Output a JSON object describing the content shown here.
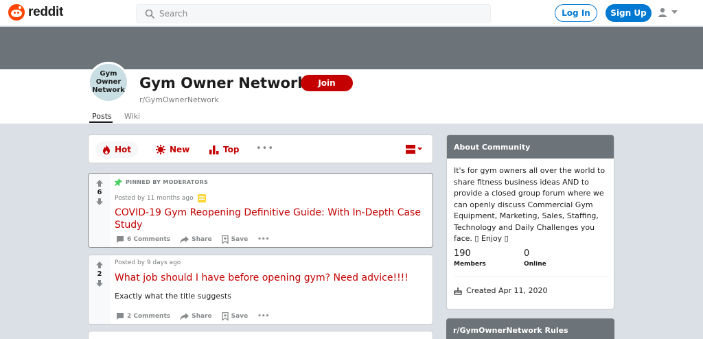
{
  "header": {
    "logo_text": "reddit",
    "search_placeholder": "Search",
    "login_label": "Log In",
    "signup_label": "Sign Up"
  },
  "subreddit": {
    "avatar_text": "Gym Owner Network",
    "title": "Gym Owner Network",
    "join_label": "Join",
    "name": "r/GymOwnerNetwork",
    "tabs": [
      {
        "label": "Posts"
      },
      {
        "label": "Wiki"
      }
    ]
  },
  "sort": {
    "items": [
      {
        "label": "Hot",
        "icon": "flame-icon"
      },
      {
        "label": "New",
        "icon": "sun-icon"
      },
      {
        "label": "Top",
        "icon": "bar-chart-icon"
      }
    ],
    "more": "•••"
  },
  "posts": [
    {
      "pinned_label": "PINNED BY MODERATORS",
      "votes": "6",
      "meta": "Posted by 11 months ago",
      "title": "COVID-19 Gym Reopening Definitive Guide: With In-Depth Case Study",
      "comments": "6 Comments",
      "share": "Share",
      "save": "Save",
      "more": "•••"
    },
    {
      "votes": "2",
      "meta": "Posted by 9 days ago",
      "title": "What job should I have before opening gym? Need advice!!!!",
      "text": "Exactly what the title suggests",
      "comments": "2 Comments",
      "share": "Share",
      "save": "Save",
      "more": "•••"
    }
  ],
  "about": {
    "title": "About Community",
    "description": "It's for gym owners all over the world to share fitness business ideas AND to provide a closed group forum where we can openly discuss Commercial Gym Equipment, Marketing, Sales, Staffing, Technology and Daily Challenges you face. ▯ Enjoy ▯",
    "members_count": "190",
    "members_label": "Members",
    "online_count": "0",
    "online_label": "Online",
    "created": "Created Apr 11, 2020"
  },
  "rules": {
    "title": "r/GymOwnerNetwork Rules"
  },
  "colors": {
    "accent": "#c40000",
    "blue": "#0079d3",
    "banner": "#6c7379"
  }
}
